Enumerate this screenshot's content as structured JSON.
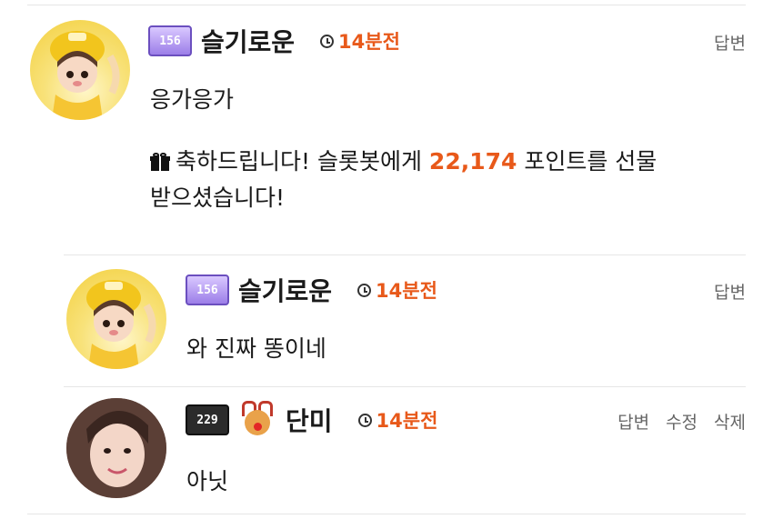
{
  "comments": [
    {
      "level": "156",
      "username": "슬기로운",
      "time": "14분전",
      "actions": [
        "답변"
      ],
      "text": "응가응가",
      "gift_prefix": "축하드립니다! 슬롯봇에게 ",
      "gift_points": "22,174",
      "gift_suffix_line1": " 포인트를 선물",
      "gift_suffix_line2": "받으셨습니다!"
    },
    {
      "level": "156",
      "username": "슬기로운",
      "time": "14분전",
      "actions": [
        "답변"
      ],
      "text": "와 진짜 똥이네"
    },
    {
      "level": "229",
      "username": "단미",
      "time": "14분전",
      "actions": [
        "답변",
        "수정",
        "삭제"
      ],
      "text": "아닛"
    }
  ],
  "colors": {
    "accent": "#e8591a",
    "divider": "#e6e6e6",
    "action_text": "#666666"
  },
  "icons": [
    "clock-icon",
    "gift-icon",
    "level-badge-icon",
    "reindeer-icon"
  ]
}
